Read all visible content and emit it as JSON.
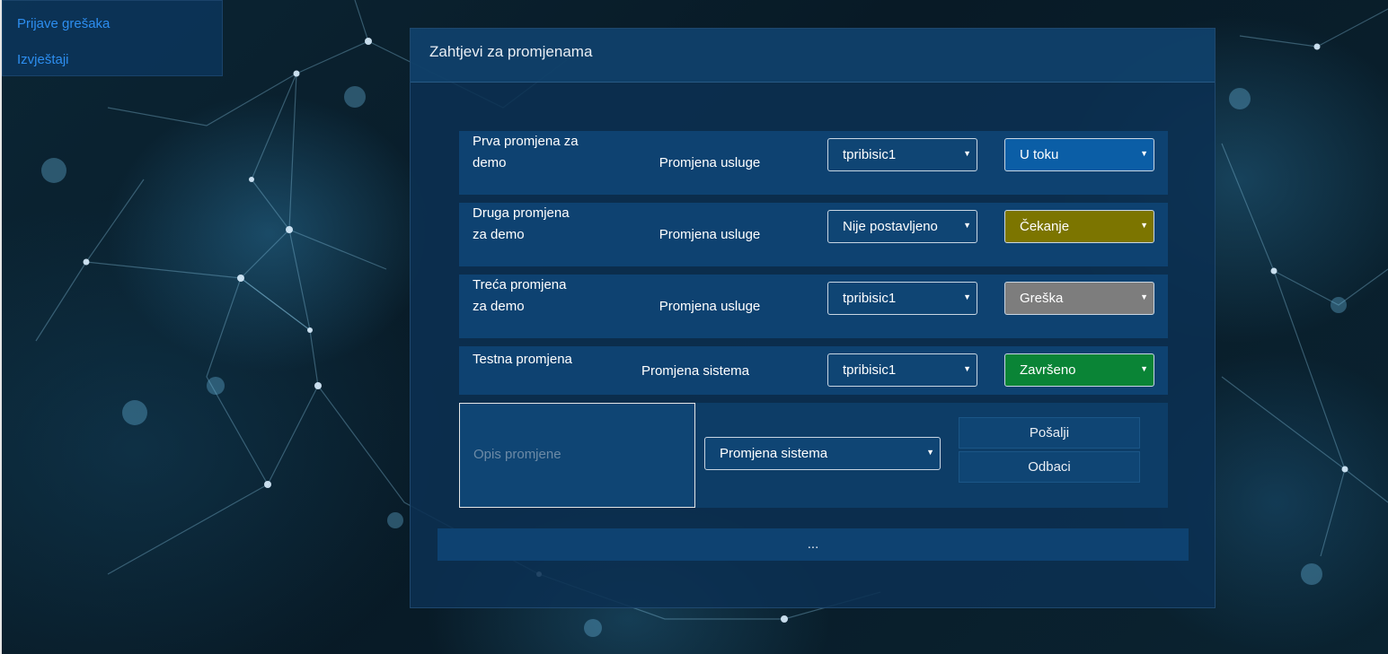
{
  "nav": {
    "items": [
      {
        "label": "Prijave grešaka"
      },
      {
        "label": "Izvještaji"
      }
    ]
  },
  "panel": {
    "title": "Zahtjevi za promjenama"
  },
  "requests": [
    {
      "name": "Prva promjena za demo",
      "type": "Promjena usluge",
      "assignee": "tpribisic1",
      "status": "U toku",
      "status_color": "#0b5ea6"
    },
    {
      "name": "Druga promjena za demo",
      "type": "Promjena usluge",
      "assignee": "Nije postavljeno",
      "status": "Čekanje",
      "status_color": "#7c7500"
    },
    {
      "name": "Treća promjena za demo",
      "type": "Promjena usluge",
      "assignee": "tpribisic1",
      "status": "Greška",
      "status_color": "#7d7d7d"
    },
    {
      "name": "Testna promjena",
      "type": "Promjena sistema",
      "assignee": "tpribisic1",
      "status": "Završeno",
      "status_color": "#0a8436"
    }
  ],
  "new_request": {
    "description_placeholder": "Opis promjene",
    "type_selected": "Promjena sistema",
    "send_label": "Pošalji",
    "discard_label": "Odbaci"
  },
  "more_label": "...",
  "icons": {
    "dropdown": "caret-down-icon"
  }
}
